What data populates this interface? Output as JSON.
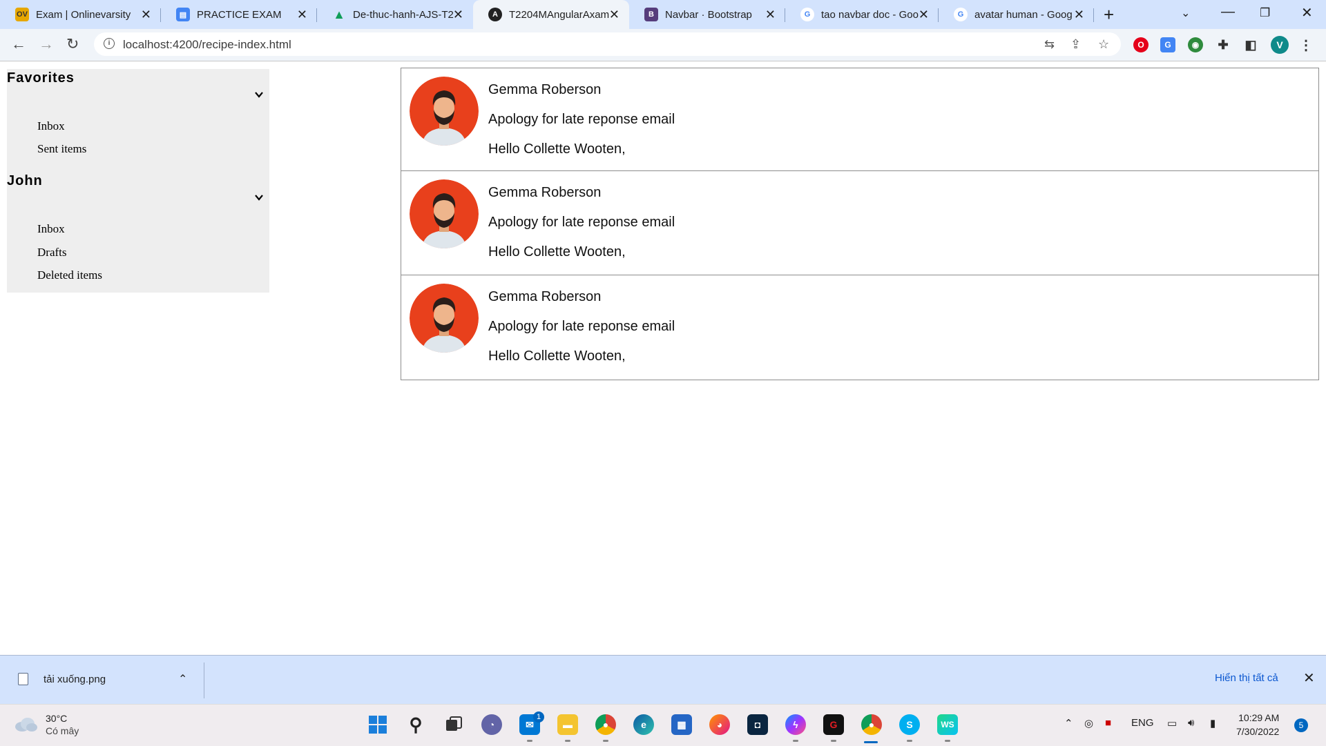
{
  "browser": {
    "tabs": [
      {
        "title": "Exam | Onlinevarsity",
        "favicon": "OV",
        "favicon_color": "#e6a700"
      },
      {
        "title": "PRACTICE EXAM",
        "favicon": "▤",
        "favicon_color": "#4285f4"
      },
      {
        "title": "De-thuc-hanh-AJS-T2",
        "favicon": "▲",
        "favicon_color": "#0f9d58"
      },
      {
        "title": "T2204MAngularAxam",
        "favicon": "A",
        "favicon_color": "#222222"
      },
      {
        "title": "Navbar · Bootstrap",
        "favicon": "B",
        "favicon_color": "#563d7c"
      },
      {
        "title": "tao navbar doc - Goo",
        "favicon": "G",
        "favicon_color": "#ffffff"
      },
      {
        "title": "avatar human - Goog",
        "favicon": "G",
        "favicon_color": "#ffffff"
      }
    ],
    "active_tab_index": 3,
    "url": "localhost:4200/recipe-index.html",
    "profile_initial": "V"
  },
  "sidebar": {
    "groups": [
      {
        "title": "Favorites",
        "items": [
          "Inbox",
          "Sent items"
        ]
      },
      {
        "title": "John",
        "items": [
          "Inbox",
          "Drafts",
          "Deleted items"
        ]
      }
    ]
  },
  "mails": [
    {
      "sender": "Gemma Roberson",
      "subject": "Apology for late reponse email",
      "preview": "Hello Collette Wooten,"
    },
    {
      "sender": "Gemma Roberson",
      "subject": "Apology for late reponse email",
      "preview": "Hello Collette Wooten,"
    },
    {
      "sender": "Gemma Roberson",
      "subject": "Apology for late reponse email",
      "preview": "Hello Collette Wooten,"
    }
  ],
  "download_bar": {
    "filename": "tải xuống.png",
    "show_all": "Hiển thị tất cả"
  },
  "taskbar": {
    "weather_temp": "30°C",
    "weather_desc": "Có mây",
    "mail_badge": "1",
    "language": "ENG",
    "time": "10:29 AM",
    "date": "7/30/2022",
    "notifications": "5"
  },
  "colors": {
    "avatar_bg": "#e8401c",
    "sidebar_bg": "#eeeeee",
    "tabstrip_bg": "#d3e3fd"
  }
}
